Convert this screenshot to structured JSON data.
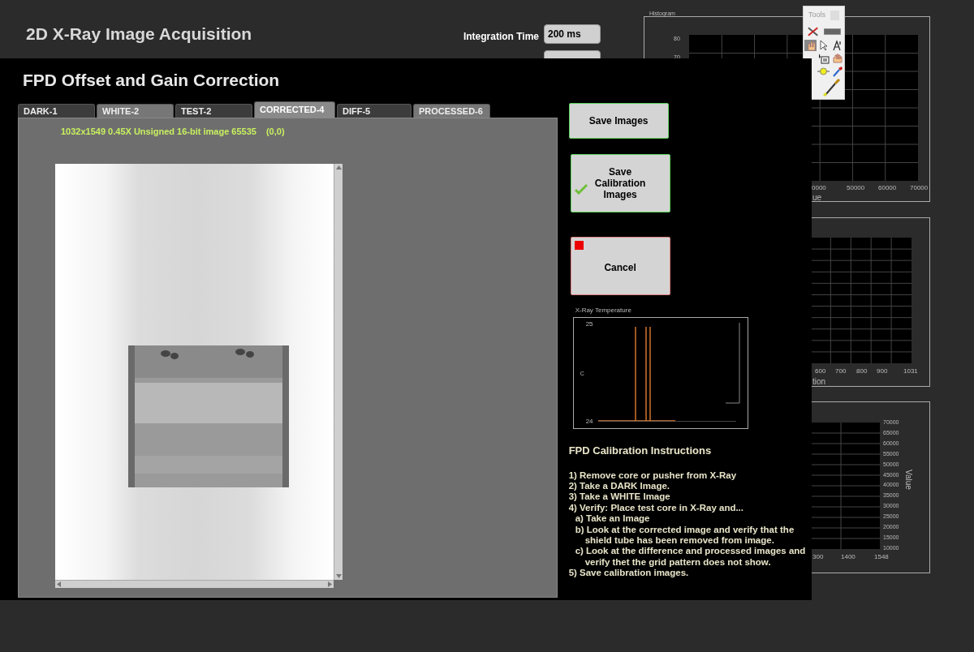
{
  "back_window": {
    "title": "2D X-Ray Image Acquisition",
    "integration_time": {
      "label": "Integration Time",
      "value": "200 ms"
    }
  },
  "histogram_panel": {
    "title": "Histogram",
    "yticks": [
      "80",
      "70"
    ],
    "xticks": [
      "0000",
      "50000",
      "60000",
      "70000"
    ],
    "xlabel": "ue"
  },
  "profile_panel": {
    "xticks": [
      "600",
      "700",
      "800",
      "900",
      "1031"
    ],
    "xlabel": "tion"
  },
  "column_panel": {
    "yticks": [
      "70000",
      "65000",
      "60000",
      "55000",
      "50000",
      "45000",
      "40000",
      "35000",
      "30000",
      "25000",
      "20000",
      "15000",
      "10000"
    ],
    "ylabel": "Value",
    "xticks": [
      "300",
      "1400",
      "1548"
    ]
  },
  "tools": {
    "title": "Tools"
  },
  "dialog": {
    "title": "FPD Offset and Gain Correction",
    "tabs": [
      {
        "label": "DARK-1",
        "selected": false
      },
      {
        "label": "WHITE-2",
        "selected": false
      },
      {
        "label": "TEST-2",
        "selected": false
      },
      {
        "label": "CORRECTED-4",
        "selected": true
      },
      {
        "label": "DIFF-5",
        "selected": false
      },
      {
        "label": "PROCESSED-6",
        "selected": false
      }
    ],
    "image_info": "1032x1549 0.45X Unsigned 16-bit image 65535",
    "cursor": "(0,0)",
    "buttons": [
      {
        "kind": "plain",
        "label": "Save Images"
      },
      {
        "kind": "check",
        "label": "Save Calibration Images"
      },
      {
        "kind": "stop",
        "label": "Cancel"
      }
    ],
    "temperature_chart": {
      "title": "X-Ray Temperature",
      "yticks": [
        "25",
        "24"
      ],
      "ylabel": "C"
    },
    "instructions": {
      "title": "FPD Calibration Instructions",
      "steps": [
        {
          "text": "1) Remove core or pusher from X-Ray"
        },
        {
          "text": "2) Take a DARK Image."
        },
        {
          "text": "3) Take a WHITE Image"
        },
        {
          "text": "4) Verify: Place test core in X-Ray and...",
          "children": [
            {
              "text": "a) Take an Image"
            },
            {
              "text": "b)  Look at the corrected image and verify that the shield tube has been removed from image."
            },
            {
              "text": "c) Look at the difference and processed images and verify thet the grid pattern does not show."
            }
          ]
        },
        {
          "text": "5) Save calibration images."
        }
      ]
    }
  }
}
